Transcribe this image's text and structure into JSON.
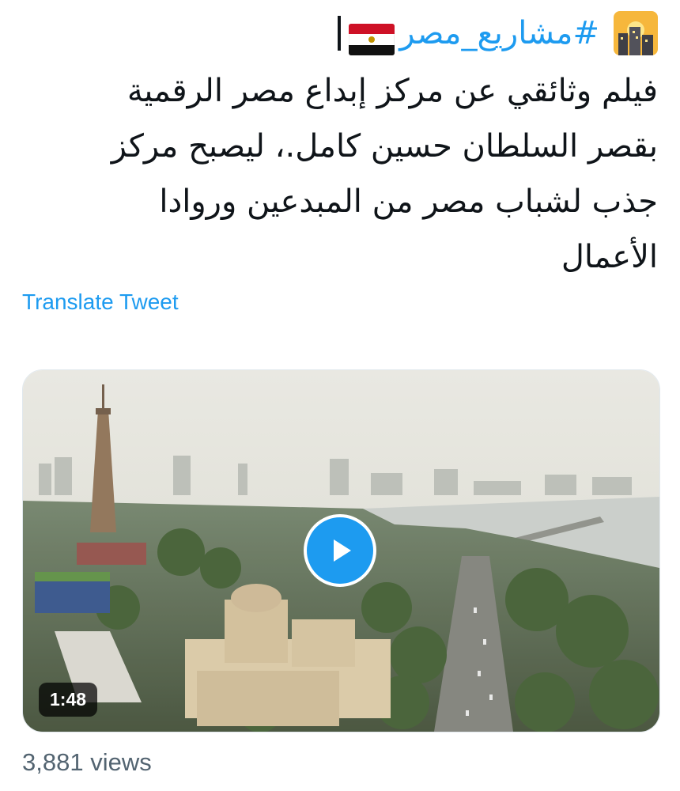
{
  "tweet": {
    "hashtag": "#مشاريع_مصر",
    "lines": [
      "فيلم وثائقي عن مركز إبداع مصر الرقمية",
      "بقصر السلطان حسين كامل.، ليصبح مركز",
      "جذب لشباب مصر من المبدعين وروادا",
      "الأعمال"
    ],
    "translate_label": "Translate Tweet"
  },
  "media": {
    "duration": "1:48"
  },
  "stats": {
    "views": "3,881 views"
  },
  "colors": {
    "link": "#1d9bf0",
    "text": "#0f1419",
    "muted": "#536471"
  },
  "icons": {
    "hashtag_emoji": "cityscape-icon",
    "flag": "egypt-flag-icon",
    "play": "play-icon"
  }
}
